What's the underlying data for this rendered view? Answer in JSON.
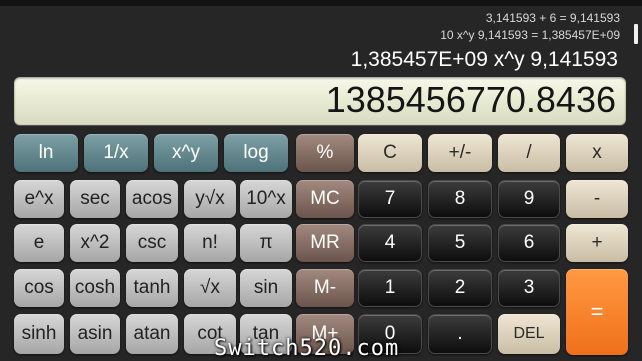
{
  "history": [
    "3,141593 + 6 = 9,141593",
    "10 x^y 9,141593 = 1,385457E+09"
  ],
  "expression": "1,385457E+09 x^y 9,141593",
  "display_value": "1385456770.8436",
  "keys": {
    "ln": "ln",
    "reciprocal": "1/x",
    "pow": "x^y",
    "log": "log",
    "percent": "%",
    "clear": "C",
    "sign": "+/-",
    "divide": "/",
    "multiply": "x",
    "exp": "e^x",
    "sec": "sec",
    "acos": "acos",
    "yroot": "y√x",
    "pow10": "10^x",
    "mc": "MC",
    "d7": "7",
    "d8": "8",
    "d9": "9",
    "minus": "-",
    "e": "e",
    "square": "x^2",
    "csc": "csc",
    "fact": "n!",
    "pi": "π",
    "mr": "MR",
    "d4": "4",
    "d5": "5",
    "d6": "6",
    "plus": "+",
    "cos": "cos",
    "cosh": "cosh",
    "tanh": "tanh",
    "sqrt": "√x",
    "sin": "sin",
    "mminus": "M-",
    "d1": "1",
    "d2": "2",
    "d3": "3",
    "equals": "=",
    "sinh": "sinh",
    "asin": "asin",
    "atan": "atan",
    "cot": "cot",
    "tan": "tan",
    "mplus": "M+",
    "d0": "0",
    "dot": ".",
    "del": "DEL"
  },
  "watermark": "Switch520.com"
}
